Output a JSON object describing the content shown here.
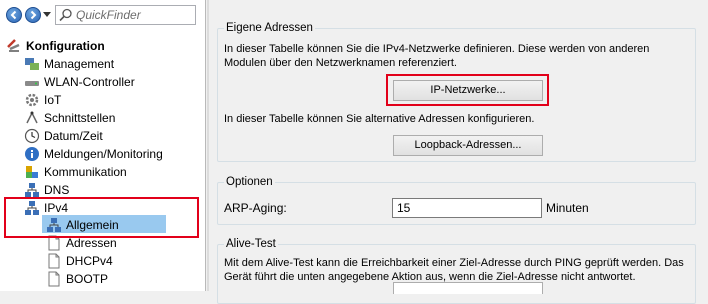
{
  "toolbar": {
    "quickfinder_placeholder": "QuickFinder"
  },
  "tree": {
    "root": "Konfiguration",
    "items": [
      {
        "label": "Management",
        "icon": "management-icon"
      },
      {
        "label": "WLAN-Controller",
        "icon": "wlan-controller-icon"
      },
      {
        "label": "IoT",
        "icon": "iot-gear-icon"
      },
      {
        "label": "Schnittstellen",
        "icon": "interfaces-icon"
      },
      {
        "label": "Datum/Zeit",
        "icon": "clock-icon"
      },
      {
        "label": "Meldungen/Monitoring",
        "icon": "info-icon"
      },
      {
        "label": "Kommunikation",
        "icon": "communication-icon"
      },
      {
        "label": "DNS",
        "icon": "network-icon"
      },
      {
        "label": "IPv4",
        "icon": "network-icon"
      }
    ],
    "ipv4_children": [
      {
        "label": "Allgemein",
        "icon": "network-icon",
        "selected": true
      },
      {
        "label": "Adressen",
        "icon": "page-icon"
      },
      {
        "label": "DHCPv4",
        "icon": "page-icon"
      },
      {
        "label": "BOOTP",
        "icon": "page-icon"
      }
    ]
  },
  "content": {
    "eigene_adressen": {
      "legend": "Eigene Adressen",
      "text1": "In dieser Tabelle können Sie die IPv4-Netzwerke definieren. Diese werden von anderen",
      "text2": "Modulen über den Netzwerknamen referenziert.",
      "ip_button": "IP-Netzwerke...",
      "text3": "In dieser Tabelle können Sie alternative Adressen konfigurieren.",
      "loopback_button": "Loopback-Adressen..."
    },
    "optionen": {
      "legend": "Optionen",
      "arp_label": "ARP-Aging:",
      "arp_value": "15",
      "arp_unit": "Minuten"
    },
    "alive_test": {
      "legend": "Alive-Test",
      "text1": "Mit dem Alive-Test kann die Erreichbarkeit einer Ziel-Adresse durch PING geprüft werden. Das",
      "text2": "Gerät führt die unten angegebene Aktion aus, wenn die Ziel-Adresse nicht antwortet."
    }
  },
  "colors": {
    "highlight_red": "#e2001a",
    "selection_blue": "#99c9ef"
  }
}
